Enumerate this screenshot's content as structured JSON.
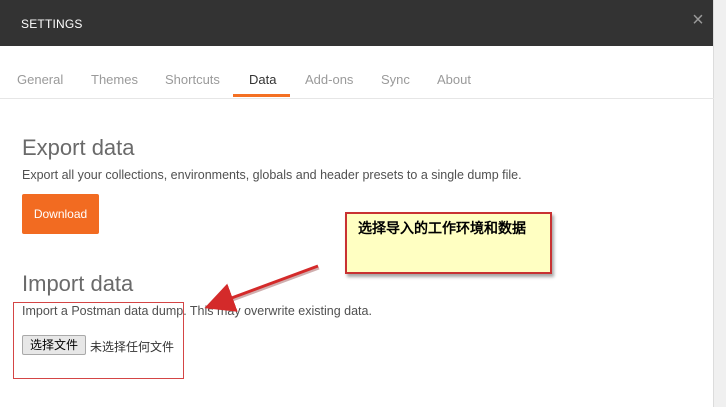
{
  "dialog": {
    "title": "SETTINGS",
    "close_glyph": "×"
  },
  "tabs": [
    {
      "label": "General",
      "active": false
    },
    {
      "label": "Themes",
      "active": false
    },
    {
      "label": "Shortcuts",
      "active": false
    },
    {
      "label": "Data",
      "active": true
    },
    {
      "label": "Add-ons",
      "active": false
    },
    {
      "label": "Sync",
      "active": false
    },
    {
      "label": "About",
      "active": false
    }
  ],
  "export": {
    "heading": "Export data",
    "description": "Export all your collections, environments, globals and header presets to a single dump file.",
    "download_label": "Download"
  },
  "import": {
    "heading": "Import data",
    "description": "Import a Postman data dump. This may overwrite existing data.",
    "file_button_label": "选择文件",
    "file_status": "未选择任何文件"
  },
  "annotation": {
    "text": "选择导入的工作环境和数据"
  },
  "colors": {
    "accent": "#f26b21",
    "titlebar": "#333333",
    "callout_bg": "#ffffc2",
    "callout_border": "#c83232"
  },
  "icons": {
    "close": "close-icon",
    "arrow": "arrow-annotation"
  }
}
